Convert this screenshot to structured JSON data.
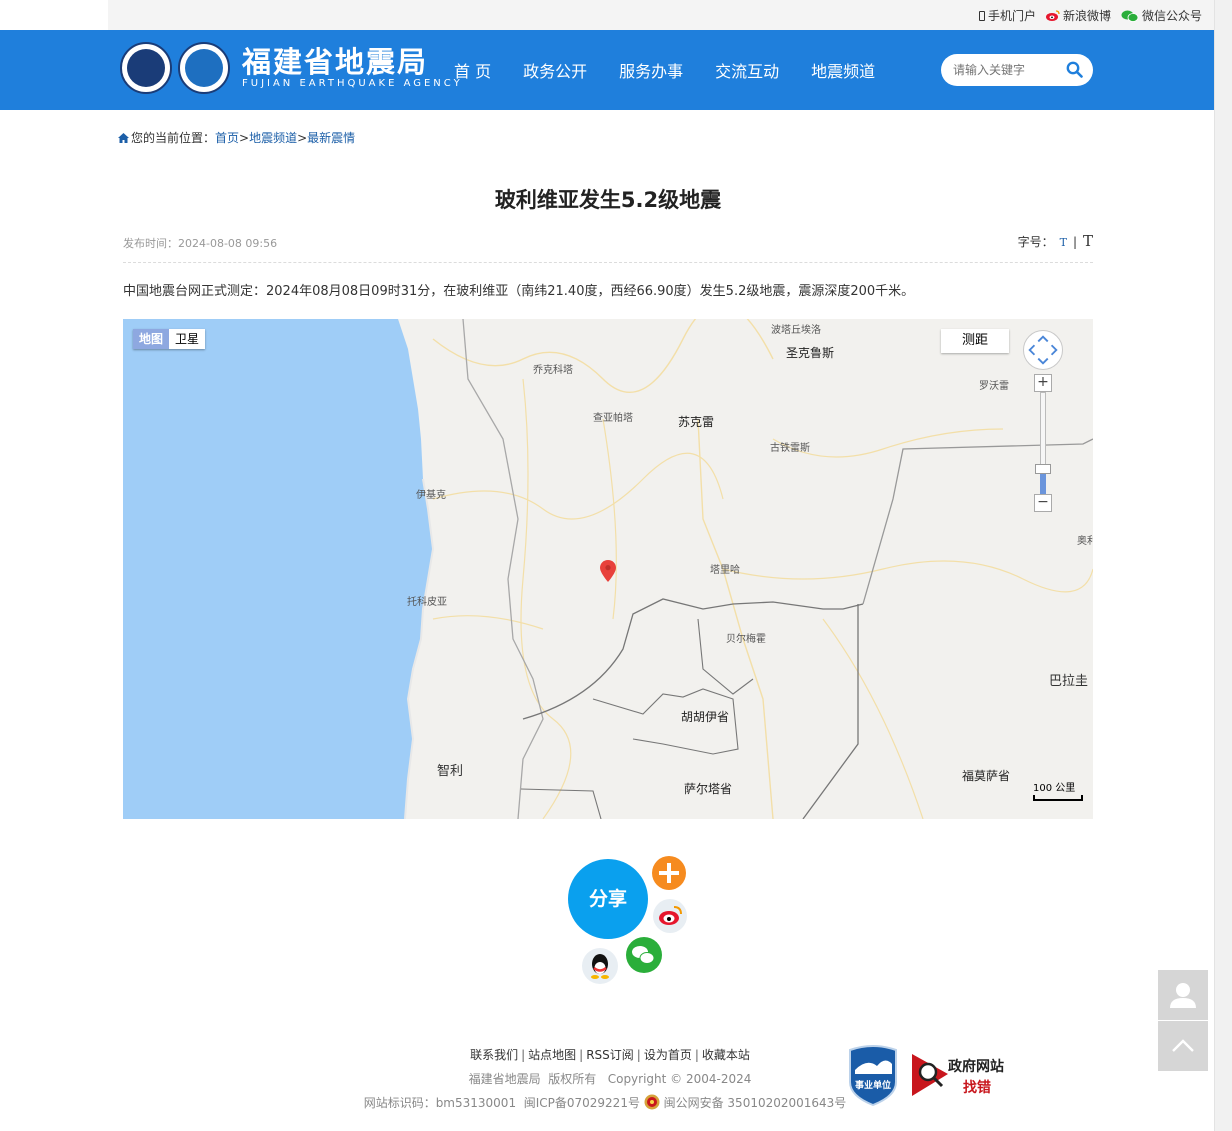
{
  "topbar": {
    "mobile": "手机门户",
    "weibo": "新浪微博",
    "wechat": "微信公众号"
  },
  "header": {
    "logo_cn": "福建省地震局",
    "logo_en": "FUJIAN EARTHQUAKE AGENCY",
    "nav": [
      "首 页",
      "政务公开",
      "服务办事",
      "交流互动",
      "地震频道"
    ],
    "search_placeholder": "请输入关键字"
  },
  "breadcrumb": {
    "prefix": "您的当前位置：",
    "items": [
      "首页",
      "地震频道",
      "最新震情"
    ],
    "sep": ">"
  },
  "article": {
    "title": "玻利维亚发生5.2级地震",
    "publish_time": "发布时间：2024-08-08 09:56",
    "font_label": "字号：",
    "font_small": "T",
    "font_sep": "|",
    "font_large": "T",
    "body": "中国地震台网正式测定：2024年08月08日09时31分，在玻利维亚（南纬21.40度，西经66.90度）发生5.2级地震，震源深度200千米。"
  },
  "map": {
    "type_map": "地图",
    "type_satellite": "卫星",
    "measure": "测距",
    "scale": "100 公里",
    "labels": {
      "w1": "波塔丘埃洛",
      "w2": "圣克鲁斯",
      "w3": "罗沃雷",
      "w4": "乔克科塔",
      "w5": "查亚帕塔",
      "w6": "苏克雷",
      "w7": "古铁雷斯",
      "w8": "伊基克",
      "w9": "奥利",
      "w10": "塔里哈",
      "w11": "托科皮亚",
      "w12": "贝尔梅霍",
      "w13": "巴拉圭",
      "w14": "胡胡伊省",
      "w15": "智利",
      "w16": "福莫萨省",
      "w17": "萨尔塔省"
    }
  },
  "share": {
    "label": "分享"
  },
  "footer": {
    "links": [
      "联系我们",
      "站点地图",
      "RSS订阅",
      "设为首页",
      "收藏本站"
    ],
    "copyright_org": "福建省地震局",
    "copyright_rights": "版权所有",
    "copyright_year": "Copyright © 2004-2024",
    "site_id": "网站标识码：bm53130001",
    "icp": "闽ICP备07029221号",
    "police": "闽公网安备 35010202001643号",
    "badge_gov_1": "政府网站",
    "badge_gov_2": "找错",
    "badge_unit": "事业单位"
  },
  "colors": {
    "header_blue": "#1f7fdc",
    "link_blue": "#1c5fa8",
    "share_blue": "#0aa0ee",
    "water": "#9fcdf7",
    "pin": "#e8413b"
  }
}
